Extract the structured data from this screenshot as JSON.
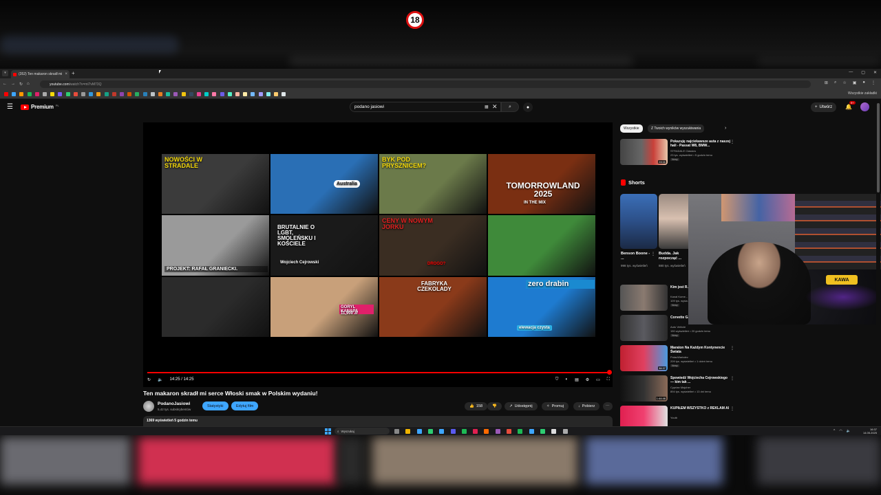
{
  "stream": {
    "age_badge": "18"
  },
  "browser": {
    "tab_title": "(352) Ten makaron skradł mi s...",
    "tab_close": "×",
    "new_tab": "+",
    "url_host": "youtube.com",
    "url_path": "/watch?v=ml7vM73Q",
    "bookmarks_all": "Wszystkie zakładki"
  },
  "masthead": {
    "brand": "Premium",
    "region": "PL",
    "search_value": "podano jasiowi",
    "create_label": "Utwórz",
    "notif_count": "9+"
  },
  "player": {
    "tiles": [
      {
        "text": "NOWOŚCI W STRADALE",
        "bg": "#3b3b3b",
        "accent": "#f5d90a"
      },
      {
        "text": "Australia",
        "bg": "#2a6fb5",
        "accent": "#e02020"
      },
      {
        "text": "BYK POD PRYSZNICEM?",
        "bg": "#6b7a4a",
        "accent": "#f5d90a"
      },
      {
        "text": "TOMORROWLAND 2025",
        "bg": "#7a2f12",
        "accent": "#ffb347"
      },
      {
        "text": "PROJEKT: RAFAŁ GRANIECKI.",
        "bg": "#9a9a9a",
        "accent": "#222222"
      },
      {
        "text": "BRUTALNIE O LGBT, SMOLEŃSKU I KOŚCIELE",
        "bg": "#1a1a1a",
        "accent": "#ffffff"
      },
      {
        "text": "CENY W NOWYM JORKU",
        "bg": "#3a2d22",
        "accent": "#e02020"
      },
      {
        "text": "",
        "bg": "#3f8a3a",
        "accent": "#f5d90a"
      },
      {
        "text": "",
        "bg": "#2b2b2b",
        "accent": "#888888"
      },
      {
        "text": "GORYL KANAPA",
        "bg": "#c8a07a",
        "accent": "#e0206a"
      },
      {
        "text": "FABRYKA CZEKOLADY",
        "bg": "#8a3a1a",
        "accent": "#f0c040"
      },
      {
        "text": "zero drabin",
        "bg": "#1e7bd0",
        "accent": "#38d0e0"
      }
    ],
    "tile_sub_in_the_mix": "IN THE MIX",
    "tile_sub_cejrowski": "Wojciech Cejrowski",
    "tile_sub_drogo": "DROGO?",
    "tile_sub_goryl_price": "11,900 zł",
    "tile_sub_elewacja": "elewacja czysta",
    "time": "14:25 / 14:25",
    "progress_fraction": 1.0
  },
  "video": {
    "title": "Ten makaron skradł mi serce Włoski smak w Polskim wydaniu!",
    "channel": "PodanoJasiowi",
    "subs": "5,42 tys. subskrybentów",
    "stats_btn": "Statystyki",
    "edit_btn": "Edytuj film",
    "likes": "158",
    "share": "Udostępnij",
    "promote": "Promuj",
    "download": "Pobierz",
    "views_line": "1369 wyświetleń  5 godzin temu"
  },
  "sidebar": {
    "chips": [
      "Wszystkie",
      "Z Twoich wyników wyszukiwania"
    ],
    "top_rec": {
      "title": "Pokazuję najciekawsze auta z naszej hali - Passat W8, BMW...",
      "channel": "STRADALE Classics",
      "meta": "23 tys. wyświetleń • 5 godzin temu",
      "badge": "Nowy",
      "duration": "24:11"
    },
    "shorts_label": "Shorts",
    "shorts": [
      {
        "title": "Benson Boone - ...",
        "views": "998 tys. wyświetleń"
      },
      {
        "title": "Budda. Jak rozpocząć ...",
        "views": "880 tys. wyświetleń"
      }
    ],
    "recs": [
      {
        "title": "Kim jest R... Kasper Ru...",
        "channel": "Kanał Kome...",
        "meta": "109 tys. wyśw...",
        "badge": "Nowy",
        "duration": ""
      },
      {
        "title": "Corvette G... roku SZOKU...",
        "channel": "Auto Vehicle",
        "meta": "150 wyświetleń • 20 godzin temu",
        "badge": "Nowy",
        "duration": ""
      },
      {
        "title": "Maraton Na Każdym Kontynencie Świata",
        "channel": "PotacWartalez",
        "meta": "209 tys. wyświetleń • 1 dzień temu",
        "badge": "Nowy",
        "duration": "38:37"
      },
      {
        "title": "Spowiedź Wojciecha Cejrowskiego — kim tak ...",
        "channel": "Cyprian Majcher",
        "meta": "894 tys. wyświetleń • 13 dni temu",
        "badge": "",
        "duration": "1:44:46"
      },
      {
        "title": "KUPIŁEM WSZYSTKO z REKLAM AI",
        "channel": "Youtb",
        "meta": "",
        "badge": "",
        "duration": ""
      }
    ]
  },
  "webcam": {
    "sign": "KAWA"
  },
  "taskbar": {
    "search_placeholder": "Wyszukaj",
    "clock_time": "16:37",
    "clock_date": "14.05.2025"
  }
}
